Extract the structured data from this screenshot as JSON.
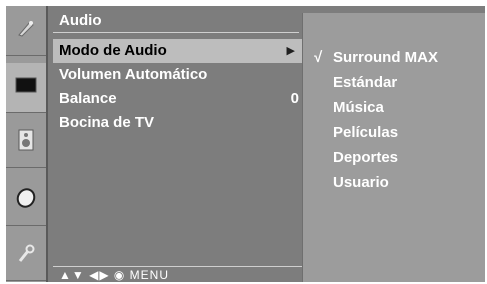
{
  "menu": {
    "title": "Audio",
    "items": [
      {
        "label": "Modo de Audio",
        "submenu_indicator": "▶",
        "selected": true
      },
      {
        "label": "Volumen Automático"
      },
      {
        "label": "Balance",
        "value": "0"
      },
      {
        "label": "Bocina de TV"
      }
    ]
  },
  "submenu": {
    "check_mark": "√",
    "items": [
      {
        "label": "Surround MAX",
        "checked": true
      },
      {
        "label": "Estándar"
      },
      {
        "label": "Música"
      },
      {
        "label": "Películas"
      },
      {
        "label": "Deportes"
      },
      {
        "label": "Usuario"
      }
    ]
  },
  "navigation": {
    "hints": "▲▼ ◀▶ ◉ MENU"
  },
  "side_icons": [
    "picture-setting-icon",
    "screen-icon",
    "speaker-icon",
    "time-icon",
    "option-icon"
  ],
  "colors": {
    "osd_background": "#7d7d7d",
    "submenu_background": "#9c9c9c",
    "selection_highlight": "#bdbdbd",
    "text": "#ffffff"
  }
}
